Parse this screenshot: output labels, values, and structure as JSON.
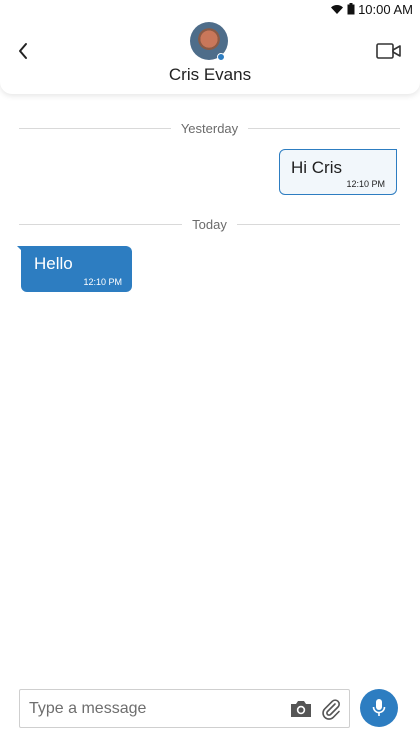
{
  "status_bar": {
    "time": "10:00 AM"
  },
  "header": {
    "contact_name": "Cris Evans",
    "online": true
  },
  "messages": {
    "separators": [
      "Yesterday",
      "Today"
    ],
    "outgoing": {
      "text": "Hi Cris",
      "time": "12:10 PM"
    },
    "incoming": {
      "text": "Hello",
      "time": "12:10 PM"
    }
  },
  "composer": {
    "placeholder": "Type a message",
    "value": ""
  },
  "icons": {
    "back": "chevron-left-icon",
    "video": "video-camera-icon",
    "camera": "camera-icon",
    "attach": "paperclip-icon",
    "mic": "microphone-icon",
    "wifi": "wifi-icon",
    "battery": "battery-icon"
  },
  "colors": {
    "accent": "#2d7dc1",
    "outgoing_bubble_bg": "#f2f7fb",
    "separator": "#d9d9d9"
  }
}
